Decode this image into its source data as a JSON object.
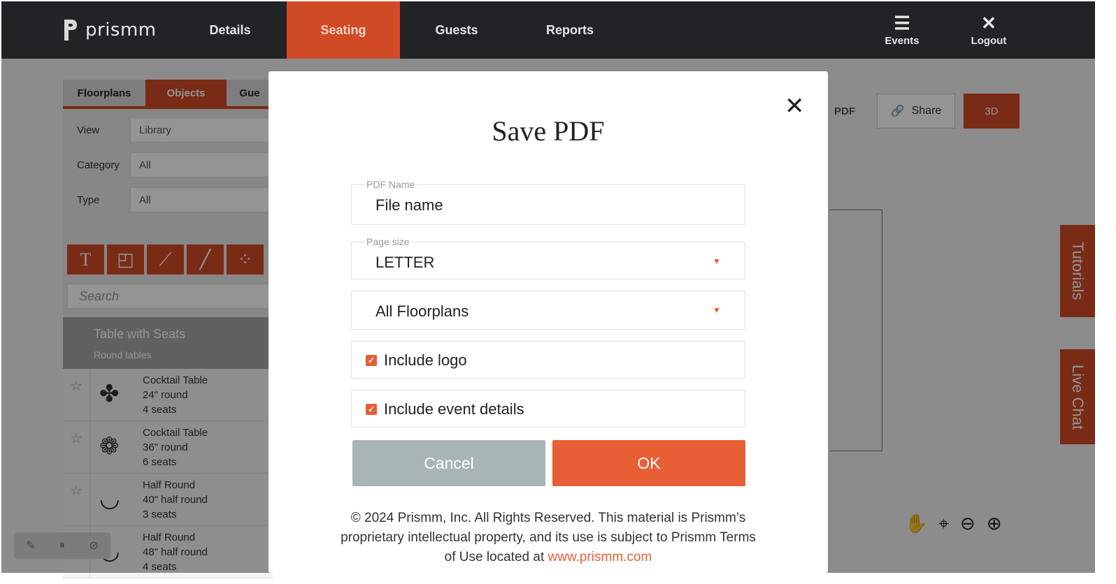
{
  "nav": {
    "brand": "prismm",
    "tabs": [
      {
        "label": "Details"
      },
      {
        "label": "Seating"
      },
      {
        "label": "Guests"
      },
      {
        "label": "Reports"
      }
    ],
    "events_label": "Events",
    "logout_label": "Logout",
    "events_icon": "hamburger-menu-icon",
    "logout_icon": "close-icon"
  },
  "panel": {
    "tabs": [
      "Floorplans",
      "Objects",
      "Gue"
    ],
    "view_label": "View",
    "view_value": "Library",
    "category_label": "Category",
    "category_value": "All",
    "type_label": "Type",
    "type_value": "All",
    "tools": [
      "text-tool-icon",
      "shapes-tool-icon",
      "ruler-tool-icon",
      "line-tool-icon",
      "seats-tool-icon"
    ],
    "search_placeholder": "Search",
    "group_title": "Table with Seats",
    "group_subtitle": "Round tables",
    "items": [
      {
        "name": "Cocktail Table",
        "size": "24\" round",
        "seats": "4 seats"
      },
      {
        "name": "Cocktail Table",
        "size": "36\" round",
        "seats": "6 seats"
      },
      {
        "name": "Half Round",
        "size": "40\" half round",
        "seats": "3 seats"
      },
      {
        "name": "Half Round",
        "size": "48\" half round",
        "seats": "4 seats"
      }
    ]
  },
  "toolbar": {
    "pdf_label": "PDF",
    "share_label": "Share",
    "view3d_label": "3D"
  },
  "side_tabs": {
    "tutorials": "Tutorials",
    "live_chat": "Live Chat"
  },
  "modal": {
    "title": "Save PDF",
    "pdf_name_legend": "PDF Name",
    "pdf_name_value": "File name",
    "page_size_legend": "Page size",
    "page_size_value": "LETTER",
    "floorplans_value": "All Floorplans",
    "include_logo_label": "Include logo",
    "include_logo_checked": true,
    "include_event_details_label": "Include event details",
    "include_event_details_checked": true,
    "cancel_label": "Cancel",
    "ok_label": "OK",
    "footer_text": "© 2024 Prismm, Inc. All Rights Reserved. This material is Prismm’s proprietary intellectual property, and its use is subject to Prismm Terms of Use located at",
    "footer_link": "www.prismm.com"
  },
  "colors": {
    "accent": "#e85e35",
    "nav_bg": "#222325",
    "nav_active": "#d04a26",
    "cancel_bg": "#a8b5b5"
  }
}
